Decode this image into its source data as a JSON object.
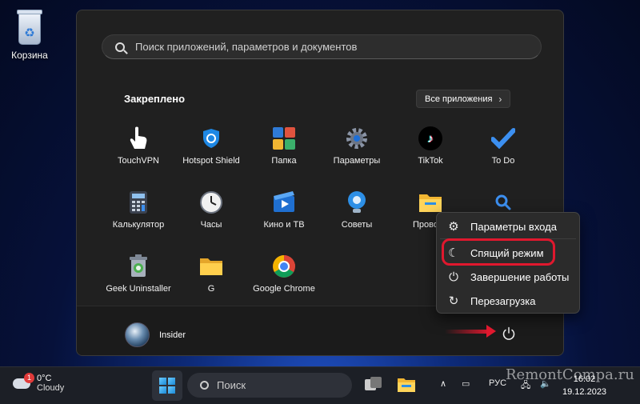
{
  "desktop": {
    "recycle_bin_label": "Корзина"
  },
  "start_menu": {
    "search_placeholder": "Поиск приложений, параметров и документов",
    "pinned_title": "Закреплено",
    "all_apps_label": "Все приложения",
    "pinned": [
      {
        "name": "TouchVPN",
        "icon": "touchvpn-icon"
      },
      {
        "name": "Hotspot Shield",
        "icon": "hotspot-shield-icon"
      },
      {
        "name": "Папка",
        "icon": "folder-apps-icon"
      },
      {
        "name": "Параметры",
        "icon": "settings-gear-icon"
      },
      {
        "name": "TikTok",
        "icon": "tiktok-icon"
      },
      {
        "name": "To Do",
        "icon": "todo-check-icon"
      },
      {
        "name": "Калькулятор",
        "icon": "calculator-icon"
      },
      {
        "name": "Часы",
        "icon": "clock-icon"
      },
      {
        "name": "Кино и ТВ",
        "icon": "movies-tv-icon"
      },
      {
        "name": "Советы",
        "icon": "tips-bulb-icon"
      },
      {
        "name": "Проводник",
        "icon": "file-explorer-icon"
      },
      {
        "name": "",
        "icon": "search-app-icon"
      },
      {
        "name": "Geek Uninstaller",
        "icon": "geek-uninstaller-icon"
      },
      {
        "name": "G",
        "icon": "folder-icon"
      },
      {
        "name": "Google Chrome",
        "icon": "chrome-icon"
      }
    ],
    "user_name": "Insider"
  },
  "power_menu": {
    "items": [
      {
        "label": "Параметры входа",
        "icon": "gear-icon"
      },
      {
        "label": "Спящий режим",
        "icon": "moon-icon"
      },
      {
        "label": "Завершение работы",
        "icon": "power-icon"
      },
      {
        "label": "Перезагрузка",
        "icon": "restart-icon"
      }
    ]
  },
  "taskbar": {
    "weather_temp": "0°C",
    "weather_desc": "Cloudy",
    "weather_badge": "1",
    "search_placeholder": "Поиск",
    "language": "РУС",
    "time": "16:02",
    "date": "19.12.2023"
  },
  "watermark": "RemontCompa.ru",
  "colors": {
    "highlight": "#e0182e",
    "accent": "#1a8ad8"
  }
}
